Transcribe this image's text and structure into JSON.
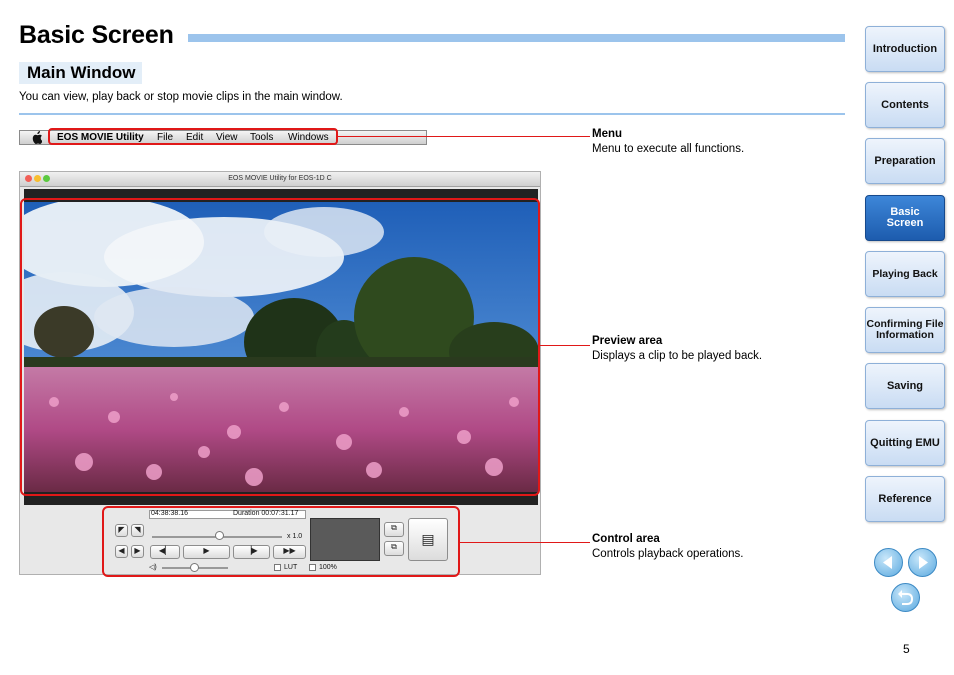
{
  "header": {
    "title": "Basic Screen",
    "subtitle": "Main Window",
    "intro": "You can view, play back or stop movie clips in the main window."
  },
  "menubar": {
    "apple_icon": "apple-logo-icon",
    "items": [
      "EOS MOVIE Utility",
      "File",
      "Edit",
      "View",
      "Tools",
      "Windows"
    ]
  },
  "window": {
    "title": "EOS MOVIE Utility for EOS-1D C"
  },
  "controls": {
    "timecode": "04:38:38.16",
    "duration": "Duration 00:07:31.17",
    "speed": "x 1.0",
    "lut_label": "LUT",
    "zoom_label": "100%"
  },
  "callouts": [
    {
      "title": "Menu",
      "desc": "Menu to execute all functions."
    },
    {
      "title": "Preview area",
      "desc": "Displays a clip to be played back."
    },
    {
      "title": "Control area",
      "desc": "Controls playback operations."
    }
  ],
  "nav": {
    "items": [
      "Introduction",
      "Contents",
      "Preparation",
      "Basic Screen",
      "Playing Back",
      "Confirming File Information",
      "Saving",
      "Quitting EMU",
      "Reference"
    ],
    "active": "Basic Screen",
    "prev_icon": "triangle-left-icon",
    "next_icon": "triangle-right-icon",
    "back_icon": "return-arrow-icon"
  },
  "page_number": "5",
  "colors": {
    "accent_bar": "#9cc4ec",
    "highlight": "#e01818",
    "nav_active": "#1d5cae"
  }
}
